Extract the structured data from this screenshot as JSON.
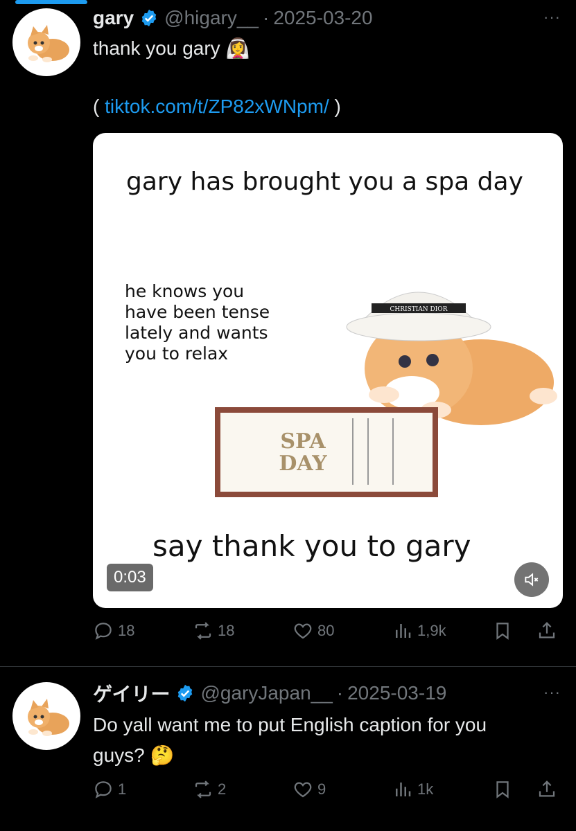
{
  "tweets": [
    {
      "name": "gary",
      "handle": "@higary__",
      "date": "2025-03-20",
      "separator": "·",
      "text": "thank you gary",
      "emoji": "👰‍♀️",
      "link_open": "(",
      "link": "tiktok.com/t/ZP82xWNpm/",
      "link_close": ")",
      "media": {
        "headline": "gary has brought you a spa day",
        "body_lines": [
          "he knows you",
          "have been tense",
          "lately and wants",
          "you to relax"
        ],
        "hat_text": "CHRISTIAN DIOR",
        "ticket_line1": "SPA",
        "ticket_line2": "DAY",
        "footer": "say thank you to gary",
        "duration": "0:03"
      },
      "stats": {
        "replies": "18",
        "reposts": "18",
        "likes": "80",
        "views": "1,9k"
      }
    },
    {
      "name": "ゲイリー",
      "handle": "@garyJapan__",
      "date": "2025-03-19",
      "separator": "·",
      "text_line1": "Do yall want me to put English caption for you",
      "text_line2": "guys?",
      "emoji": "🤔",
      "stats": {
        "replies": "1",
        "reposts": "2",
        "likes": "9",
        "views": "1k"
      }
    }
  ],
  "more_label": "···",
  "colors": {
    "accent": "#1d9bf0",
    "muted": "#71767b",
    "background": "#000000"
  }
}
